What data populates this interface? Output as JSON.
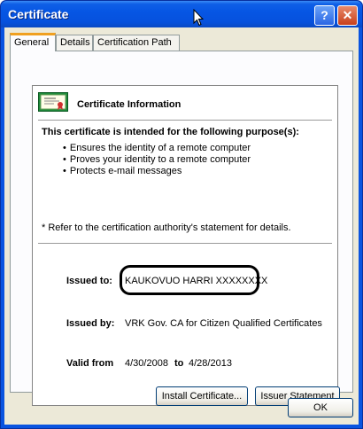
{
  "window": {
    "title": "Certificate",
    "help_glyph": "?",
    "close_glyph": "✕"
  },
  "tabs": [
    {
      "label": "General"
    },
    {
      "label": "Details"
    },
    {
      "label": "Certification Path"
    }
  ],
  "general": {
    "info_title": "Certificate Information",
    "purpose_heading": "This certificate is intended for the following purpose(s):",
    "purposes": [
      "Ensures the identity of a remote computer",
      "Proves your identity to a remote computer",
      "Protects e-mail messages"
    ],
    "refer_note": "* Refer to the certification authority's statement for details.",
    "issued_to_label": "Issued to:",
    "issued_to_value": "KAUKOVUO HARRI XXXXXXXX",
    "issued_by_label": "Issued by:",
    "issued_by_value": "VRK Gov. CA for Citizen Qualified Certificates",
    "valid_from_label": "Valid from",
    "valid_from_value": "4/30/2008",
    "valid_to_label": "to",
    "valid_to_value": "4/28/2013"
  },
  "buttons": {
    "install": "Install Certificate...",
    "issuer_statement": "Issuer Statement",
    "ok": "OK"
  }
}
